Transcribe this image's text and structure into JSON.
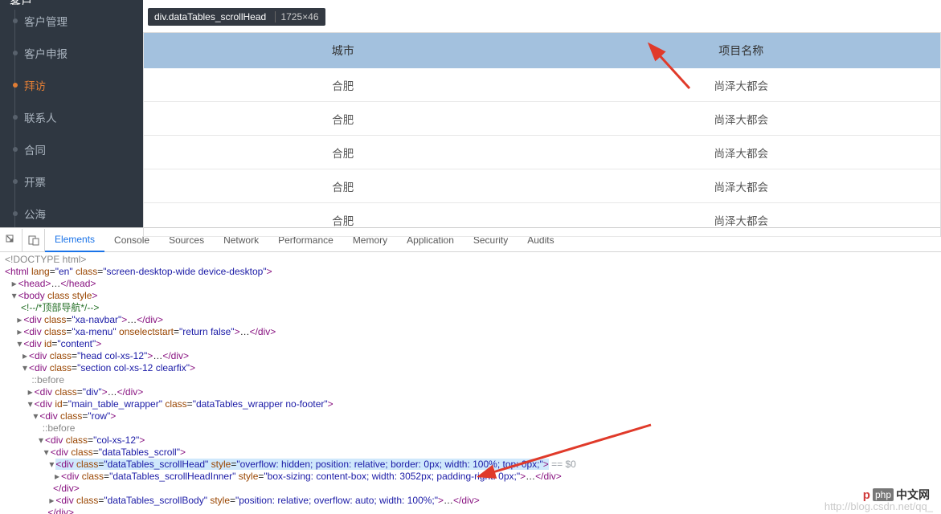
{
  "sidebar": {
    "header_icon": "客户",
    "items": [
      {
        "label": "客户管理"
      },
      {
        "label": "客户申报"
      },
      {
        "label": "拜访",
        "active": true
      },
      {
        "label": "联系人"
      },
      {
        "label": "合同"
      },
      {
        "label": "开票"
      },
      {
        "label": "公海"
      }
    ]
  },
  "tooltip": {
    "selector": "div.dataTables_scrollHead",
    "dims": "1725×46"
  },
  "table": {
    "headers": [
      "城市",
      "项目名称"
    ],
    "rows": [
      [
        "合肥",
        "尚泽大都会"
      ],
      [
        "合肥",
        "尚泽大都会"
      ],
      [
        "合肥",
        "尚泽大都会"
      ],
      [
        "合肥",
        "尚泽大都会"
      ],
      [
        "合肥",
        "尚泽大都会"
      ]
    ]
  },
  "devtools": {
    "tabs": [
      "Elements",
      "Console",
      "Sources",
      "Network",
      "Performance",
      "Memory",
      "Application",
      "Security",
      "Audits"
    ],
    "active_tab": "Elements",
    "eq0": " == $0",
    "lines": {
      "l0": "<!DOCTYPE html>",
      "l1_open": "<html ",
      "l1_attr_lang": "lang",
      "l1_val_lang": "\"en\"",
      "l1_attr_class": "class",
      "l1_val_class": "\"screen-desktop-wide device-desktop\"",
      "l1_close": ">",
      "l2": "<head>…</head>",
      "l3_open": "<body ",
      "l3_attr_class": "class",
      "l3_attr_style": "style",
      "l3_close": ">",
      "l4": "<!--/*顶部导航*/-->",
      "l5": "<div class=\"xa-navbar\">…</div>",
      "l6": "<div class=\"xa-menu\" onselectstart=\"return false\">…</div>",
      "l7": "<div id=\"content\">",
      "l8": "<div class=\"head col-xs-12\">…</div>",
      "l9": "<div class=\"section col-xs-12 clearfix\">",
      "l10": "::before",
      "l11": "<div class=\"div\">…</div>",
      "l12": "<div id=\"main_table_wrapper\" class=\"dataTables_wrapper no-footer\">",
      "l13": "<div class=\"row\">",
      "l14": "::before",
      "l15": "<div class=\"col-xs-12\">",
      "l16": "<div class=\"dataTables_scroll\">",
      "l17": "<div class=\"dataTables_scrollHead\" style=\"overflow: hidden; position: relative; border: 0px; width: 100%; top: 0px;\">",
      "l18": "<div class=\"dataTables_scrollHeadInner\" style=\"box-sizing: content-box; width: 3052px; padding-right: 0px;\">…</div>",
      "l19": "</div>",
      "l20": "<div class=\"dataTables_scrollBody\" style=\"position: relative; overflow: auto; width: 100%;\">…</div>",
      "l21": "</div>"
    }
  },
  "watermark": "http://blog.csdn.net/qq_",
  "logo": {
    "p": "p",
    "php": "php",
    "cn": "中文网"
  }
}
